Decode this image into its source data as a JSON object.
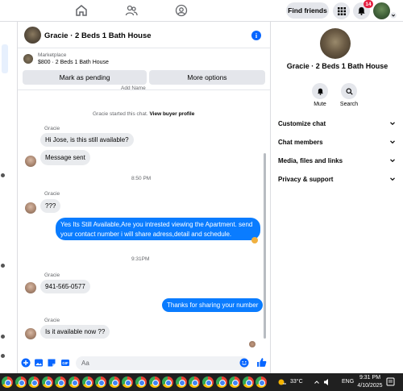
{
  "topbar": {
    "find_friends": "Find friends",
    "notification_count": "14",
    "icons": [
      "home-icon",
      "friends-icon",
      "groups-icon",
      "menu-grid-icon",
      "bell-icon"
    ]
  },
  "chat": {
    "title": "Gracie · 2 Beds 1 Bath House",
    "info_icon": "i",
    "marketplace_label": "Marketplace",
    "listing": "$800 · 2 Beds 1 Bath House",
    "mark_pending": "Mark as pending",
    "more_options": "More options",
    "partial_top": "Add        Name",
    "started_text": "Gracie started this chat.",
    "view_profile": "View buyer profile",
    "messages": [
      {
        "sender": "Gracie",
        "text": "Hi Jose, is this still available?",
        "side": "left"
      },
      {
        "text": "Message sent",
        "side": "left"
      },
      {
        "time": "8:50 PM"
      },
      {
        "sender": "Gracie",
        "text": "???",
        "side": "left"
      },
      {
        "text_line1": "Yes Its Still Available,Are you intrested viewing the Apartment. send",
        "text_line2": "your contact number i will share adress,detail and schedule.",
        "side": "right"
      },
      {
        "time": "9:31PM"
      },
      {
        "sender": "Gracie",
        "text": "941-565-0577",
        "side": "left"
      },
      {
        "text": "Thanks for sharing your number",
        "side": "right"
      },
      {
        "sender": "Gracie",
        "text": "Is it available now ??",
        "side": "left"
      }
    ],
    "compose_placeholder": "Aa"
  },
  "right_panel": {
    "title": "Gracie · 2 Beds 1 Bath House",
    "mute": "Mute",
    "search": "Search",
    "sections": [
      "Customize chat",
      "Chat members",
      "Media, files and links",
      "Privacy & support"
    ]
  },
  "taskbar": {
    "weather": "33°C",
    "lang": "ENG",
    "time": "9:31 PM",
    "date": "4/10/2025",
    "app_count": 20
  },
  "colors": {
    "accent": "#0866ff",
    "bubble_blue": "#0a7cff",
    "bubble_gray": "#e9ebee",
    "badge_red": "#e41e3f"
  }
}
